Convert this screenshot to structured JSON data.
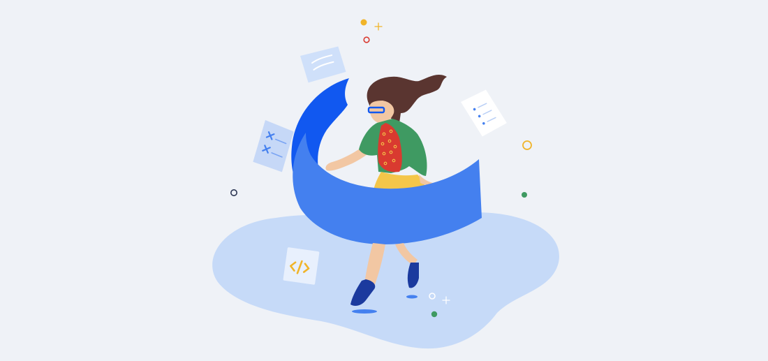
{
  "illustration": {
    "subject": "woman-running-with-blue-ribbon",
    "palette": {
      "background": "#eff2f7",
      "puddle": "#c6daf8",
      "ribbon_front": "#4480ef",
      "ribbon_back": "#1158f0",
      "hair": "#5a3530",
      "skin": "#f2c7a3",
      "jacket": "#3f9a62",
      "shirt": "#d93a30",
      "skirt": "#f4c64a",
      "shoes": "#1b3a9e",
      "paper": "#dde8fb",
      "paper_lines": "#ffffff",
      "accent_yellow": "#f0b429",
      "accent_red": "#d93a30",
      "accent_green": "#3f9a62",
      "accent_navy": "#2b3552"
    },
    "floating_papers": [
      {
        "icon": "lines-document-icon"
      },
      {
        "icon": "todo-list-document-icon"
      },
      {
        "icon": "checklist-document-icon"
      },
      {
        "icon": "code-document-icon"
      }
    ]
  }
}
